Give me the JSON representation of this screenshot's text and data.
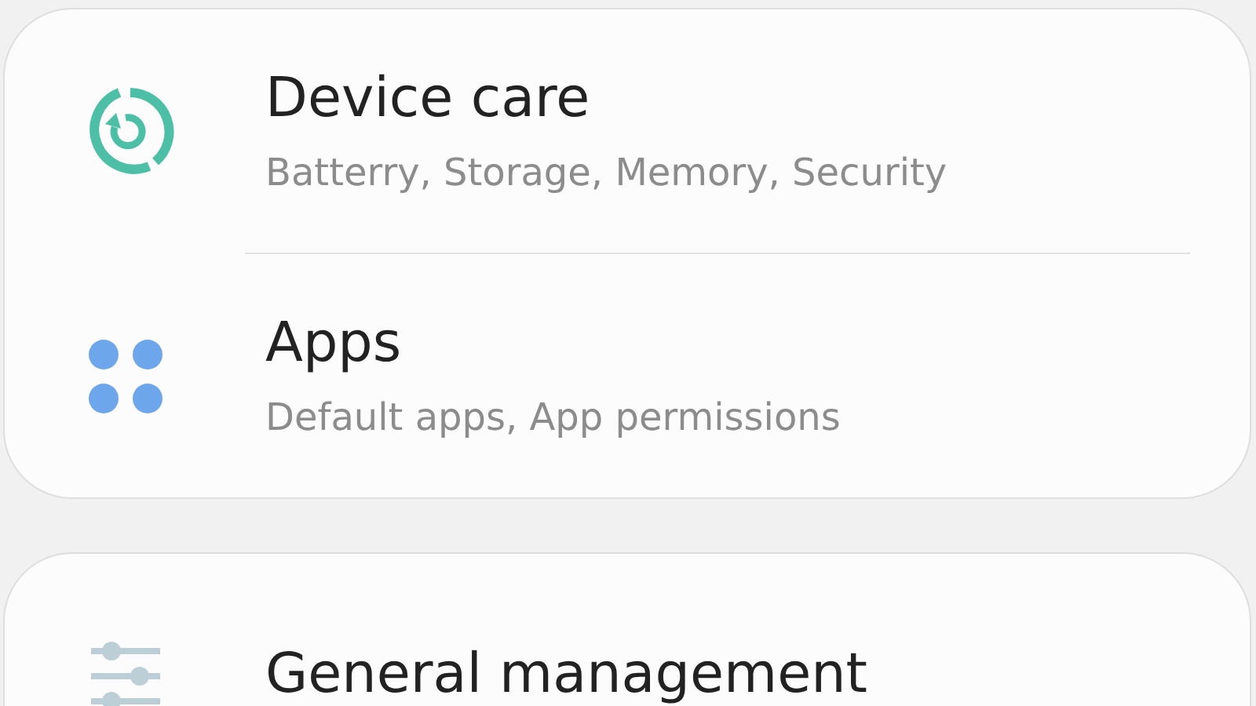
{
  "cards": [
    {
      "items": [
        {
          "kind": "care",
          "title": "Device care",
          "subtitle": "Batterry, Storage, Memory, Security"
        },
        {
          "kind": "apps",
          "title": "Apps",
          "subtitle": "Default apps, App permissions"
        }
      ]
    },
    {
      "items": [
        {
          "kind": "general",
          "title": "General management"
        }
      ]
    }
  ]
}
